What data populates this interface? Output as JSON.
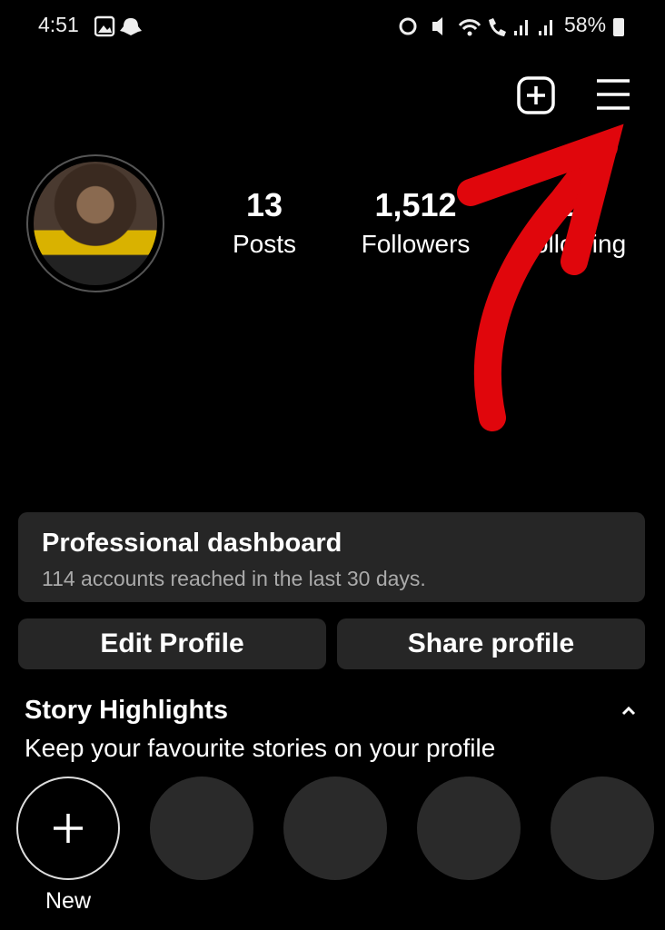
{
  "status_bar": {
    "time": "4:51",
    "battery": "58%",
    "icons": [
      "gallery-icon",
      "snapchat-icon",
      "alarm-icon",
      "mute-icon",
      "wifi-icon",
      "wifi-call-icon",
      "signal-icon",
      "signal-icon",
      "battery-icon"
    ]
  },
  "header": {
    "icons": [
      "add-post-icon",
      "menu-icon"
    ]
  },
  "stats": [
    {
      "value": "13",
      "label": "Posts"
    },
    {
      "value": "1,512",
      "label": "Followers"
    },
    {
      "value": "2",
      "label": "Following"
    }
  ],
  "dashboard": {
    "title": "Professional dashboard",
    "subtitle": "114 accounts reached in the last 30 days."
  },
  "buttons": {
    "edit": "Edit Profile",
    "share": "Share profile"
  },
  "highlights": {
    "title": "Story Highlights",
    "subtitle": "Keep your favourite stories on your profile",
    "new_label": "New"
  },
  "colors": {
    "background": "#000000",
    "card": "#262626",
    "annotation_arrow": "#e0060c"
  }
}
